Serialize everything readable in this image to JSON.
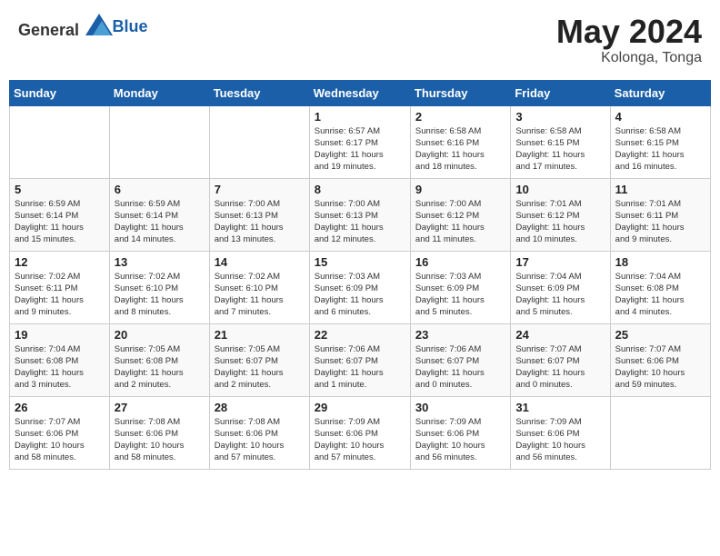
{
  "header": {
    "logo_general": "General",
    "logo_blue": "Blue",
    "month_year": "May 2024",
    "location": "Kolonga, Tonga"
  },
  "days_of_week": [
    "Sunday",
    "Monday",
    "Tuesday",
    "Wednesday",
    "Thursday",
    "Friday",
    "Saturday"
  ],
  "weeks": [
    [
      {
        "day": "",
        "info": ""
      },
      {
        "day": "",
        "info": ""
      },
      {
        "day": "",
        "info": ""
      },
      {
        "day": "1",
        "info": "Sunrise: 6:57 AM\nSunset: 6:17 PM\nDaylight: 11 hours\nand 19 minutes."
      },
      {
        "day": "2",
        "info": "Sunrise: 6:58 AM\nSunset: 6:16 PM\nDaylight: 11 hours\nand 18 minutes."
      },
      {
        "day": "3",
        "info": "Sunrise: 6:58 AM\nSunset: 6:15 PM\nDaylight: 11 hours\nand 17 minutes."
      },
      {
        "day": "4",
        "info": "Sunrise: 6:58 AM\nSunset: 6:15 PM\nDaylight: 11 hours\nand 16 minutes."
      }
    ],
    [
      {
        "day": "5",
        "info": "Sunrise: 6:59 AM\nSunset: 6:14 PM\nDaylight: 11 hours\nand 15 minutes."
      },
      {
        "day": "6",
        "info": "Sunrise: 6:59 AM\nSunset: 6:14 PM\nDaylight: 11 hours\nand 14 minutes."
      },
      {
        "day": "7",
        "info": "Sunrise: 7:00 AM\nSunset: 6:13 PM\nDaylight: 11 hours\nand 13 minutes."
      },
      {
        "day": "8",
        "info": "Sunrise: 7:00 AM\nSunset: 6:13 PM\nDaylight: 11 hours\nand 12 minutes."
      },
      {
        "day": "9",
        "info": "Sunrise: 7:00 AM\nSunset: 6:12 PM\nDaylight: 11 hours\nand 11 minutes."
      },
      {
        "day": "10",
        "info": "Sunrise: 7:01 AM\nSunset: 6:12 PM\nDaylight: 11 hours\nand 10 minutes."
      },
      {
        "day": "11",
        "info": "Sunrise: 7:01 AM\nSunset: 6:11 PM\nDaylight: 11 hours\nand 9 minutes."
      }
    ],
    [
      {
        "day": "12",
        "info": "Sunrise: 7:02 AM\nSunset: 6:11 PM\nDaylight: 11 hours\nand 9 minutes."
      },
      {
        "day": "13",
        "info": "Sunrise: 7:02 AM\nSunset: 6:10 PM\nDaylight: 11 hours\nand 8 minutes."
      },
      {
        "day": "14",
        "info": "Sunrise: 7:02 AM\nSunset: 6:10 PM\nDaylight: 11 hours\nand 7 minutes."
      },
      {
        "day": "15",
        "info": "Sunrise: 7:03 AM\nSunset: 6:09 PM\nDaylight: 11 hours\nand 6 minutes."
      },
      {
        "day": "16",
        "info": "Sunrise: 7:03 AM\nSunset: 6:09 PM\nDaylight: 11 hours\nand 5 minutes."
      },
      {
        "day": "17",
        "info": "Sunrise: 7:04 AM\nSunset: 6:09 PM\nDaylight: 11 hours\nand 5 minutes."
      },
      {
        "day": "18",
        "info": "Sunrise: 7:04 AM\nSunset: 6:08 PM\nDaylight: 11 hours\nand 4 minutes."
      }
    ],
    [
      {
        "day": "19",
        "info": "Sunrise: 7:04 AM\nSunset: 6:08 PM\nDaylight: 11 hours\nand 3 minutes."
      },
      {
        "day": "20",
        "info": "Sunrise: 7:05 AM\nSunset: 6:08 PM\nDaylight: 11 hours\nand 2 minutes."
      },
      {
        "day": "21",
        "info": "Sunrise: 7:05 AM\nSunset: 6:07 PM\nDaylight: 11 hours\nand 2 minutes."
      },
      {
        "day": "22",
        "info": "Sunrise: 7:06 AM\nSunset: 6:07 PM\nDaylight: 11 hours\nand 1 minute."
      },
      {
        "day": "23",
        "info": "Sunrise: 7:06 AM\nSunset: 6:07 PM\nDaylight: 11 hours\nand 0 minutes."
      },
      {
        "day": "24",
        "info": "Sunrise: 7:07 AM\nSunset: 6:07 PM\nDaylight: 11 hours\nand 0 minutes."
      },
      {
        "day": "25",
        "info": "Sunrise: 7:07 AM\nSunset: 6:06 PM\nDaylight: 10 hours\nand 59 minutes."
      }
    ],
    [
      {
        "day": "26",
        "info": "Sunrise: 7:07 AM\nSunset: 6:06 PM\nDaylight: 10 hours\nand 58 minutes."
      },
      {
        "day": "27",
        "info": "Sunrise: 7:08 AM\nSunset: 6:06 PM\nDaylight: 10 hours\nand 58 minutes."
      },
      {
        "day": "28",
        "info": "Sunrise: 7:08 AM\nSunset: 6:06 PM\nDaylight: 10 hours\nand 57 minutes."
      },
      {
        "day": "29",
        "info": "Sunrise: 7:09 AM\nSunset: 6:06 PM\nDaylight: 10 hours\nand 57 minutes."
      },
      {
        "day": "30",
        "info": "Sunrise: 7:09 AM\nSunset: 6:06 PM\nDaylight: 10 hours\nand 56 minutes."
      },
      {
        "day": "31",
        "info": "Sunrise: 7:09 AM\nSunset: 6:06 PM\nDaylight: 10 hours\nand 56 minutes."
      },
      {
        "day": "",
        "info": ""
      }
    ]
  ]
}
